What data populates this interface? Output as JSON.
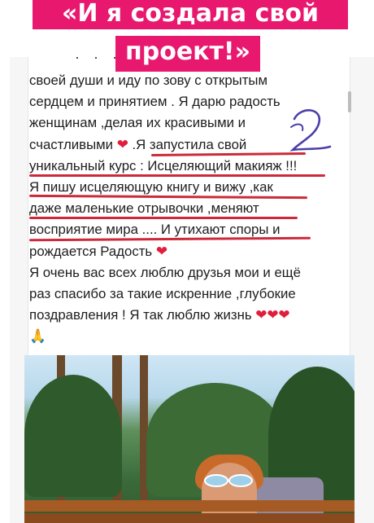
{
  "banner": {
    "line1": "«И я создала свой",
    "line2": "проект!»"
  },
  "post": {
    "dots": "· · ·",
    "lines": [
      "своей души и иду по зову с открытым",
      "сердцем и принятием . Я дарю радость",
      "женщинам ,делая их красивыми и",
      "счастливыми",
      ".Я запустила свой",
      "уникальный курс : Исцеляющий макияж !!!",
      "Я пишу исцеляющую книгу и вижу ,как",
      "даже маленькие отрывочки ,меняют",
      "восприятие мира .... И утихают споры и",
      "рождается Радость",
      "Я очень вас всех люблю друзья мои и ещё",
      "раз спасибо за такие искренние ,глубокие",
      "поздравления ! Я так люблю жизнь"
    ],
    "heart_emoji": "❤",
    "hearts_triple": "❤❤❤",
    "pray_emoji": "🙏"
  },
  "annotation": {
    "scribble_color": "#4b3fa8",
    "underline_color": "#cc2a3a"
  },
  "colors": {
    "banner_bg": "#e8186f",
    "banner_text": "#ffffff",
    "body_text": "#1e1e1e"
  }
}
